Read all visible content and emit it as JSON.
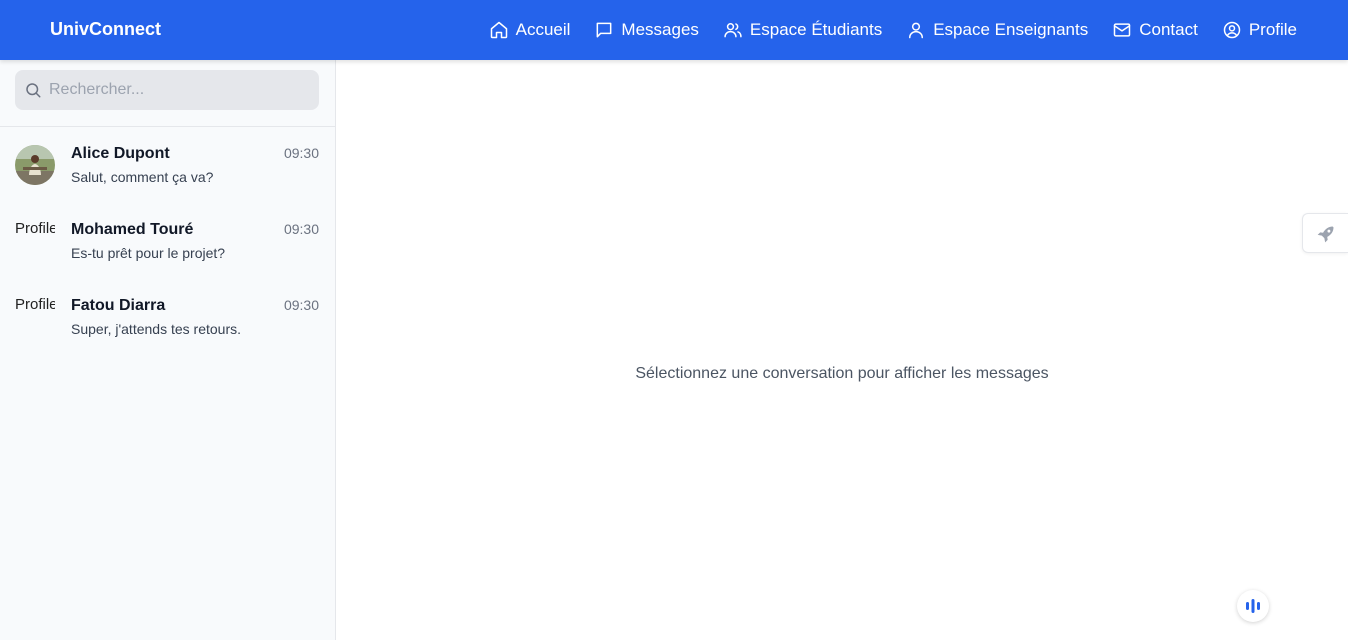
{
  "brand": "UnivConnect",
  "nav": [
    {
      "label": "Accueil",
      "icon": "home-icon"
    },
    {
      "label": "Messages",
      "icon": "message-icon"
    },
    {
      "label": "Espace Étudiants",
      "icon": "users-icon"
    },
    {
      "label": "Espace Enseignants",
      "icon": "user-icon"
    },
    {
      "label": "Contact",
      "icon": "mail-icon"
    },
    {
      "label": "Profile",
      "icon": "user-circle-icon"
    }
  ],
  "search": {
    "placeholder": "Rechercher...",
    "value": ""
  },
  "conversations": [
    {
      "name": "Alice Dupont",
      "time": "09:30",
      "preview": "Salut, comment ça va?",
      "avatar_alt": "Profile"
    },
    {
      "name": "Mohamed Touré",
      "time": "09:30",
      "preview": "Es-tu prêt pour le projet?",
      "avatar_alt": "Profile"
    },
    {
      "name": "Fatou Diarra",
      "time": "09:30",
      "preview": "Super, j'attends tes retours.",
      "avatar_alt": "Profile"
    }
  ],
  "empty_state": "Sélectionnez une conversation pour afficher les messages",
  "colors": {
    "primary": "#2563eb",
    "sidebar_bg": "#f8fafc",
    "search_bg": "#e5e7eb"
  }
}
